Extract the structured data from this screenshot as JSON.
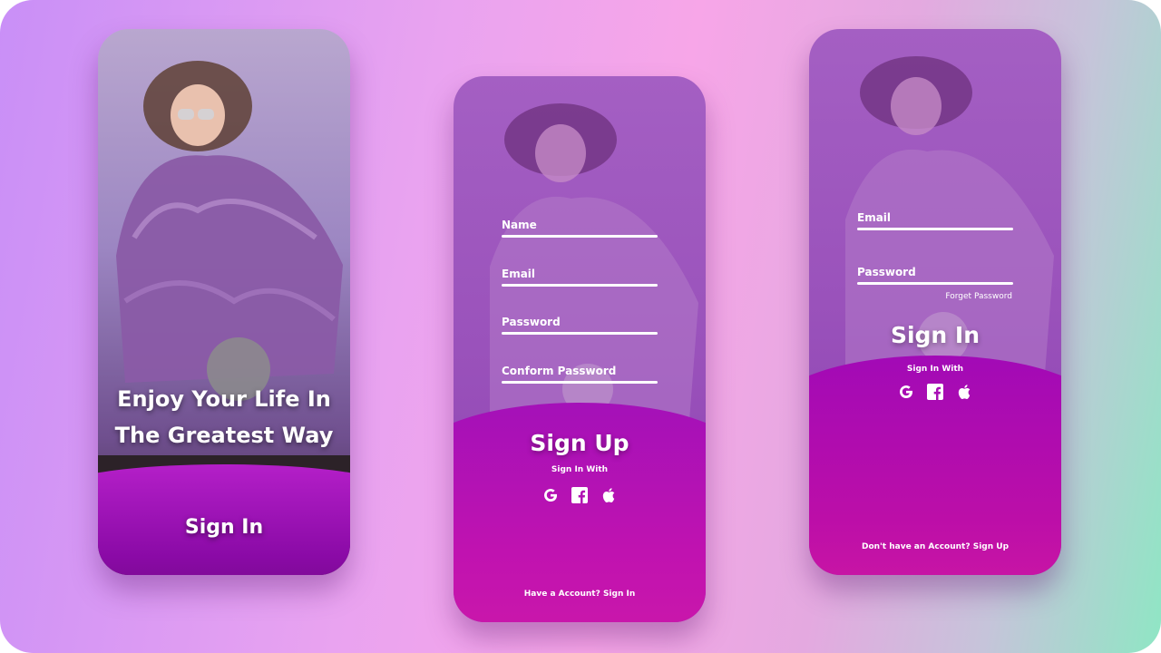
{
  "screen1": {
    "tagline_line1": "Enjoy Your Life In",
    "tagline_line2": "The Greatest Way",
    "sign_in_label": "Sign In"
  },
  "screen2": {
    "fields": {
      "name": "Name",
      "email": "Email",
      "password": "Password",
      "confirm": "Conform Password"
    },
    "title": "Sign Up",
    "sign_in_with": "Sign In With",
    "footer": "Have a Account? Sign In"
  },
  "screen3": {
    "fields": {
      "email": "Email",
      "password": "Password"
    },
    "forgot": "Forget Password",
    "title": "Sign In",
    "sign_in_with": "Sign In With",
    "footer": "Don't have an Account? Sign Up"
  },
  "icons": [
    "google-icon",
    "facebook-icon",
    "apple-icon"
  ],
  "colors": {
    "accent_purple": "#a411b8",
    "accent_magenta": "#cf1aa7",
    "text": "#ffffff"
  }
}
